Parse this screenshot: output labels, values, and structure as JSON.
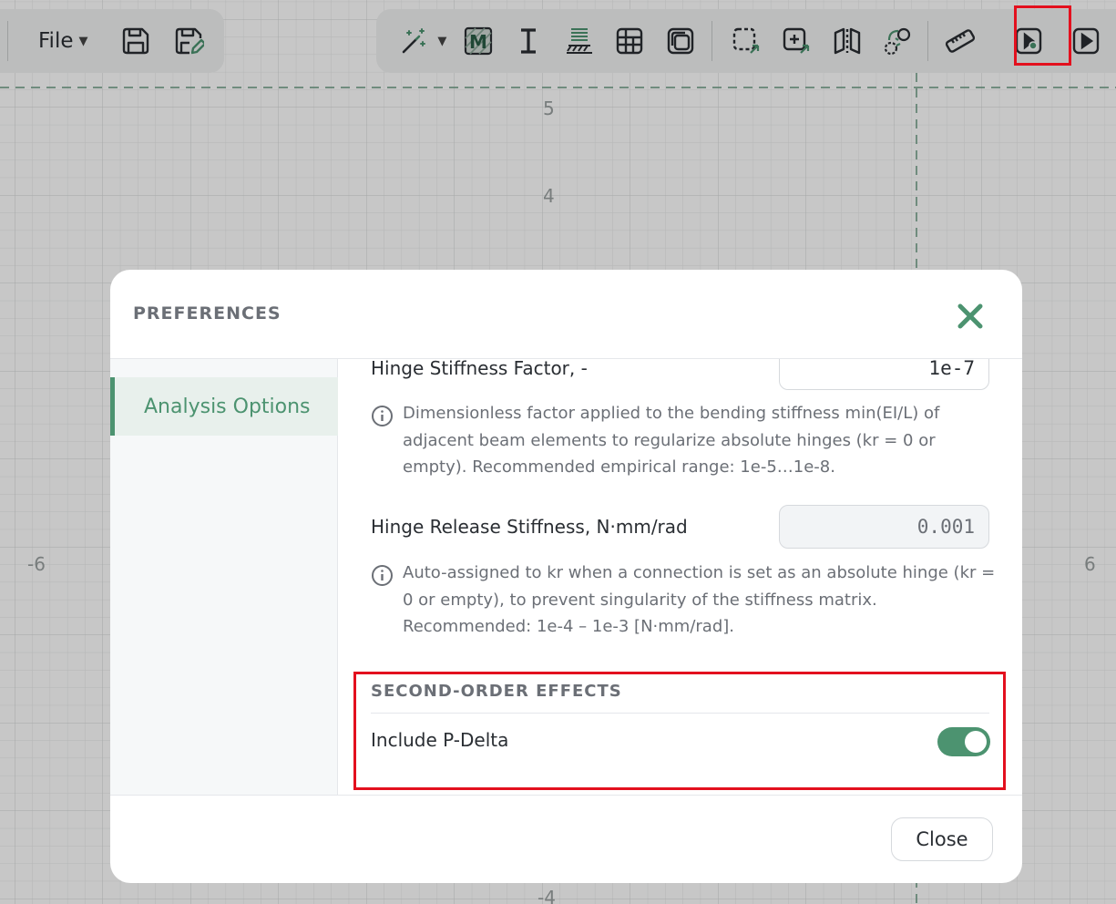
{
  "toolbar": {
    "file_label": "File",
    "icons": [
      "save-icon",
      "save-as-icon",
      "magic-wand-icon",
      "material-icon",
      "section-icon",
      "supports-icon",
      "table-icon",
      "copy-layers-icon",
      "select-area-icon",
      "add-select-icon",
      "mirror-icon",
      "node-select-icon",
      "ruler-icon",
      "run-settings-icon",
      "run-analysis-icon"
    ],
    "material_letter": "M"
  },
  "grid": {
    "labels": [
      "5",
      "4",
      "-6",
      "6",
      "-4"
    ]
  },
  "dialog": {
    "title": "PREFERENCES",
    "nav": {
      "analysis_options": "Analysis Options"
    },
    "hinge_stiffness_factor": {
      "label": "Hinge Stiffness Factor, -",
      "value": "1e-7",
      "info": "Dimensionless factor applied to the bending stiffness min(EI/L) of adjacent beam elements to regularize absolute hinges (kr = 0 or empty). Recommended empirical range: 1e-5…1e-8."
    },
    "hinge_release_stiffness": {
      "label": "Hinge Release Stiffness, N·mm/rad",
      "value": "0.001",
      "info": "Auto-assigned to kr when a connection is set as an absolute hinge (kr = 0 or empty), to prevent singularity of the stiffness matrix. Recommended: 1e-4 – 1e-3 [N·mm/rad]."
    },
    "second_order": {
      "title": "SECOND-ORDER EFFECTS",
      "p_delta_label": "Include P-Delta",
      "p_delta_enabled": true
    },
    "close_label": "Close"
  },
  "colors": {
    "accent": "#4c9370",
    "highlight": "#e3101e"
  }
}
